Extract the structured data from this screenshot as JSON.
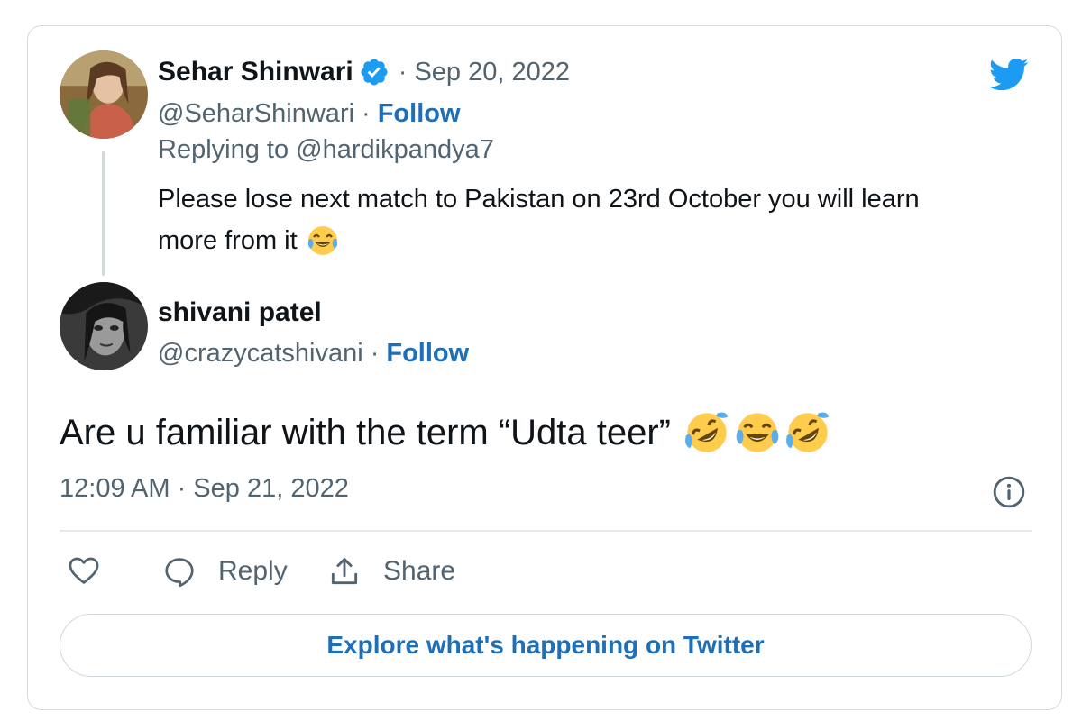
{
  "colors": {
    "twitter_blue": "#1d9bf0",
    "link_blue": "#1d6fb8",
    "muted_gray": "#536471",
    "text": "#0f1419",
    "border": "#cfd9de"
  },
  "icons": {
    "brand": "twitter-bird-icon",
    "verified": "verified-badge-icon",
    "info": "info-icon",
    "like": "heart-icon",
    "reply": "speech-bubble-icon",
    "share": "share-upload-icon"
  },
  "parent_tweet": {
    "author_name": "Sehar Shinwari",
    "date": "· Sep 20, 2022",
    "handle": "@SeharShinwari",
    "separator": "·",
    "follow_label": "Follow",
    "replying_to": "Replying to @hardikpandya7",
    "text_line1": "Please lose next match to Pakistan on 23rd October you will learn",
    "text_line2": "more from it"
  },
  "reply_tweet": {
    "author_name": "shivani patel",
    "handle": "@crazycatshivani",
    "separator": "·",
    "follow_label": "Follow",
    "text": "Are u familiar with the term “Udta teer”",
    "timestamp": "12:09 AM · Sep 21, 2022"
  },
  "actions": {
    "reply_label": "Reply",
    "share_label": "Share"
  },
  "explore_label": "Explore what's happening on Twitter"
}
